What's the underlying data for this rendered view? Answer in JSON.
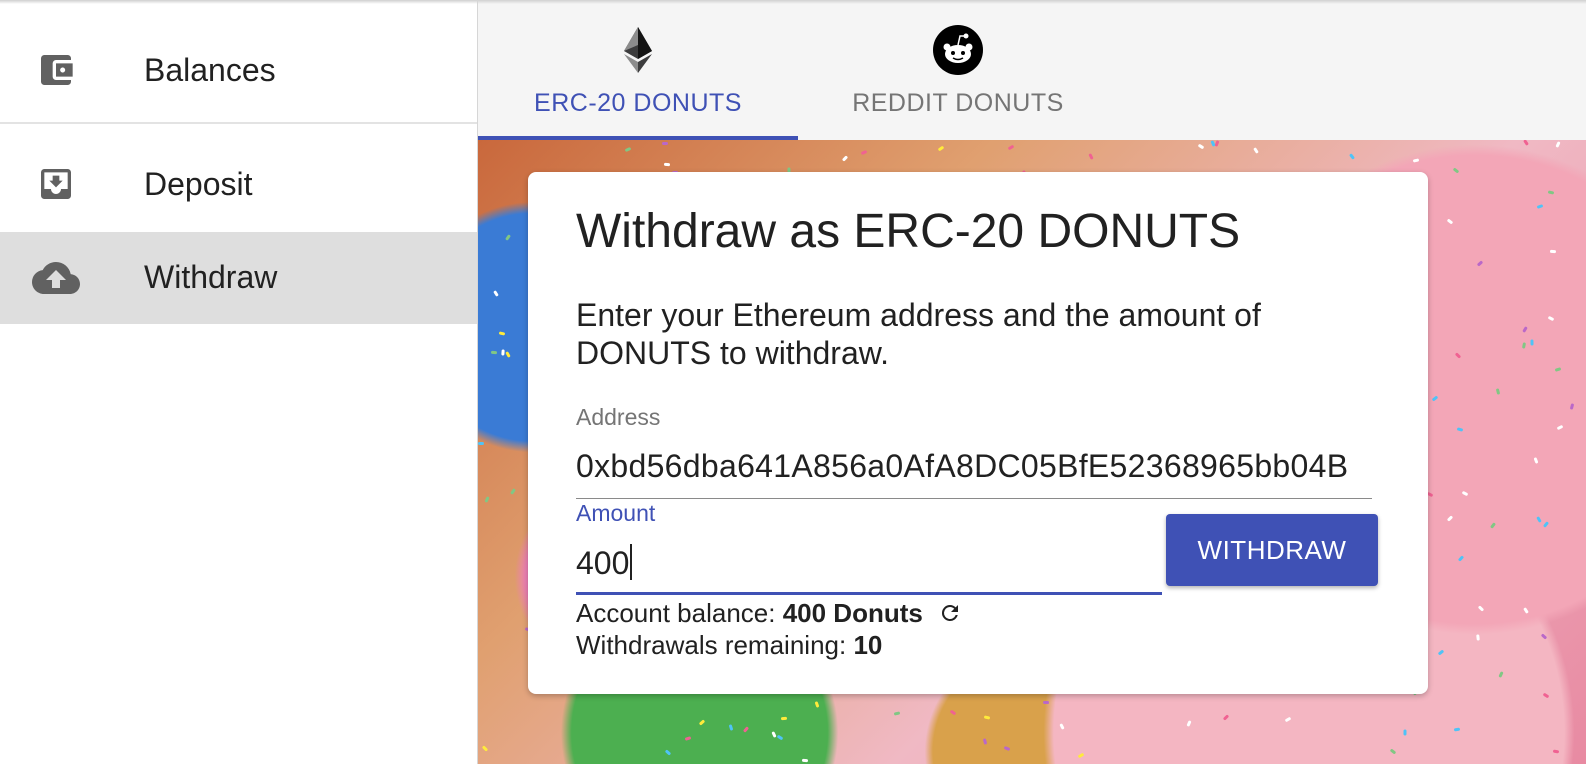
{
  "sidebar": {
    "items": [
      {
        "label": "Balances",
        "icon": "wallet-icon"
      },
      {
        "label": "Deposit",
        "icon": "download-box-icon"
      },
      {
        "label": "Withdraw",
        "icon": "cloud-upload-icon",
        "selected": true
      }
    ]
  },
  "tabs": [
    {
      "label": "ERC-20 DONUTS",
      "icon": "ethereum-icon",
      "selected": true
    },
    {
      "label": "REDDIT DONUTS",
      "icon": "reddit-icon",
      "selected": false
    }
  ],
  "card": {
    "title": "Withdraw as ERC-20 DONUTS",
    "description": "Enter your Ethereum address and the amount of DONUTS to withdraw.",
    "address": {
      "label": "Address",
      "value": "0xbd56dba641A856a0AfA8DC05BfE52368965bb04B"
    },
    "amount": {
      "label": "Amount",
      "value": "400"
    },
    "withdraw_button": "WITHDRAW",
    "balance_label": "Account balance:",
    "balance_value": "400 Donuts",
    "withdrawals_label": "Withdrawals remaining:",
    "withdrawals_value": "10"
  },
  "colors": {
    "accent": "#3f51b5",
    "selected_nav_bg": "#dedede",
    "tabbar_bg": "#f5f5f5"
  }
}
